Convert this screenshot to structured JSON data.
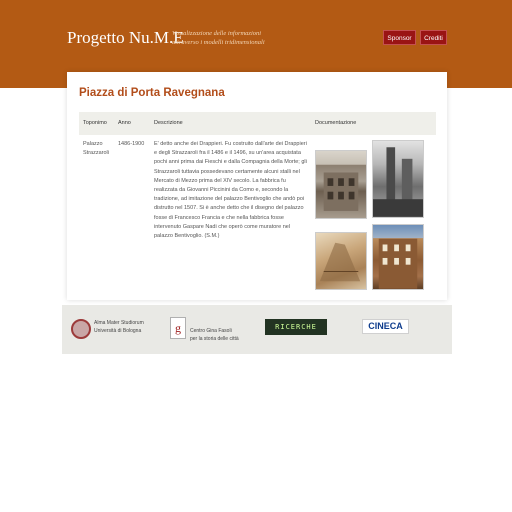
{
  "header": {
    "brand": "Progetto Nu.M.E",
    "tagline": "Visualizzazione delle informazioni attraverso i modelli tridimensionali",
    "sponsor_label": "Sponsor",
    "crediti_label": "Crediti"
  },
  "main": {
    "title": "Piazza di Porta Ravegnana",
    "columns": [
      "Toponimo",
      "Anno",
      "Descrizione",
      "Documentazione"
    ],
    "row": {
      "toponimo": "Palazzo Strazzaroli",
      "anno": "1486-1900",
      "descrizione": "E' detto anche dei Drappieri. Fu costruito dall'arte dei Drappieri e degli Strazzaroli fra il 1486 e il 1496, su un'area acquistata pochi anni prima dai Fieschi e dalla Compagnia della Morte; gli Strazzaroli tuttavia possedevano certamente alcuni stalli nel Mercato di Mezzo prima del XIV secolo. La fabbrica fu realizzata da Giovanni Piccinini da Como e, secondo la tradizione, ad imitazione del palazzo Bentivoglio che andò poi distrutto nel 1507. Si è anche detto che il disegno del palazzo fosse di Francesco Francia e che nella fabbrica fosse intervenuto Gaspare Nadi che operò come muratore nel palazzo Bentivoglio. (S.M.)"
    },
    "documentation_images": [
      "palazzo-facade-photo",
      "towers-bw-photo",
      "historic-drawing",
      "street-view-photo"
    ]
  },
  "footer": {
    "unibo_line1": "Alma Mater Studiorum",
    "unibo_line2": "Università di Bologna",
    "gina_initial": "g",
    "gina_line1": "Centro Gina Fasoli",
    "gina_line2": "per la storia delle città",
    "ricerche": "RICERCHE",
    "cineca": "CINECA"
  }
}
